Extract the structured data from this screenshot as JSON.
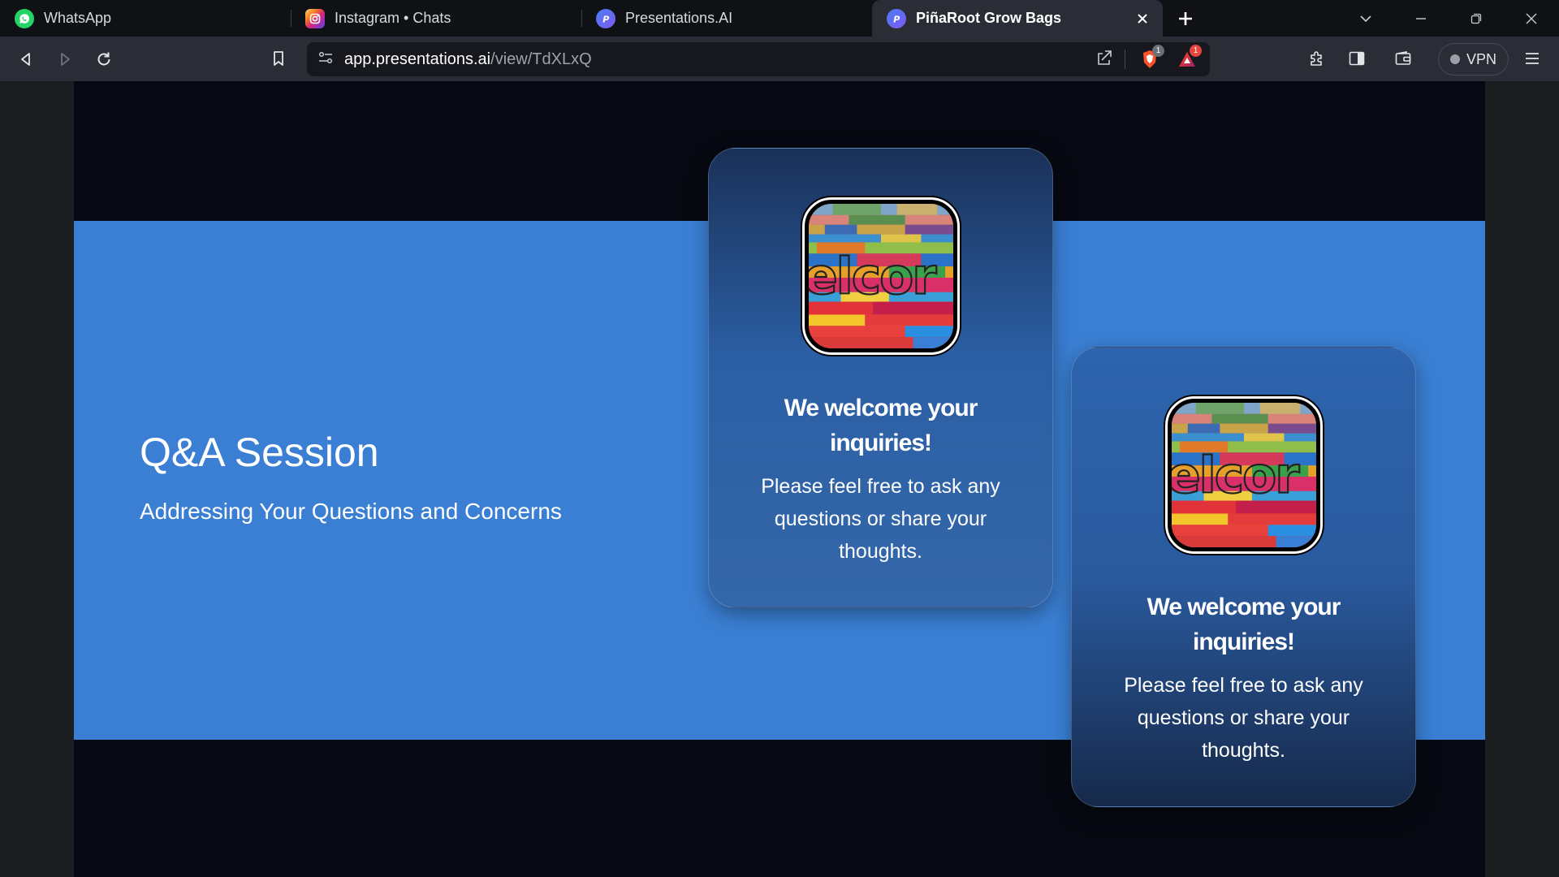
{
  "browser": {
    "tabs": [
      {
        "label": "WhatsApp",
        "icon": "whatsapp-icon",
        "active": false
      },
      {
        "label": "Instagram • Chats",
        "icon": "instagram-icon",
        "active": false
      },
      {
        "label": "Presentations.AI",
        "icon": "presentations-ai-icon",
        "active": false
      },
      {
        "label": "PiñaRoot Grow Bags",
        "icon": "presentations-ai-icon",
        "active": true
      }
    ],
    "url": {
      "host": "app.presentations.ai",
      "path": "/view/TdXLxQ"
    },
    "shields_badge": "1",
    "rewards_badge": "1",
    "vpn_label": "VPN"
  },
  "slide": {
    "title": "Q&A Session",
    "subtitle": "Addressing Your Questions and Concerns",
    "cards": [
      {
        "heading": "We welcome your inquiries!",
        "body": "Please feel free to ask any questions or share your thoughts."
      },
      {
        "heading": "We welcome your inquiries!",
        "body": "Please feel free to ask any questions or share your thoughts."
      }
    ]
  },
  "colors": {
    "band": "#3a7fd3",
    "slide_background": "#060911",
    "tab_strip": "#0f1115",
    "toolbar": "#2a2d35"
  }
}
